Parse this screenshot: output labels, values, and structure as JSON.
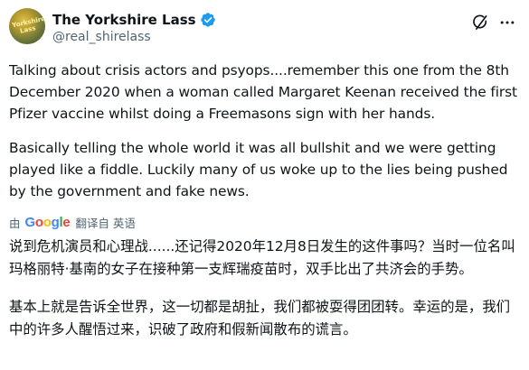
{
  "header": {
    "display_name": "The Yorkshire Lass",
    "handle": "@real_shirelass",
    "avatar_text": "Yorkshire Lass"
  },
  "tweet": {
    "paragraphs": [
      "Talking about crisis actors and psyops....remember this one from the 8th December 2020 when a woman called Margaret Keenan received the first Pfizer vaccine whilst doing a Freemasons sign with her hands.",
      "Basically telling the whole world it was all bullshit and we were getting played like a fiddle. Luckily many of us woke up to the lies being pushed by the government and fake news."
    ]
  },
  "translation": {
    "by": "由",
    "provider": "Google",
    "label": "翻译自 英语",
    "paragraphs": [
      "说到危机演员和心理战......还记得2020年12月8日发生的这件事吗？当时一位名叫玛格丽特·基南的女子在接种第一支辉瑞疫苗时，双手比出了共济会的手势。",
      "基本上就是告诉全世界，这一切都是胡扯，我们都被耍得团团转。幸运的是，我们中的许多人醒悟过来，识破了政府和假新闻散布的谎言。"
    ]
  },
  "colors": {
    "text": "#0f1419",
    "secondary": "#536471",
    "verified": "#1d9bf0"
  },
  "icons": {
    "verified": "verified-badge-icon",
    "grok": "grok-icon",
    "more": "more-icon"
  }
}
